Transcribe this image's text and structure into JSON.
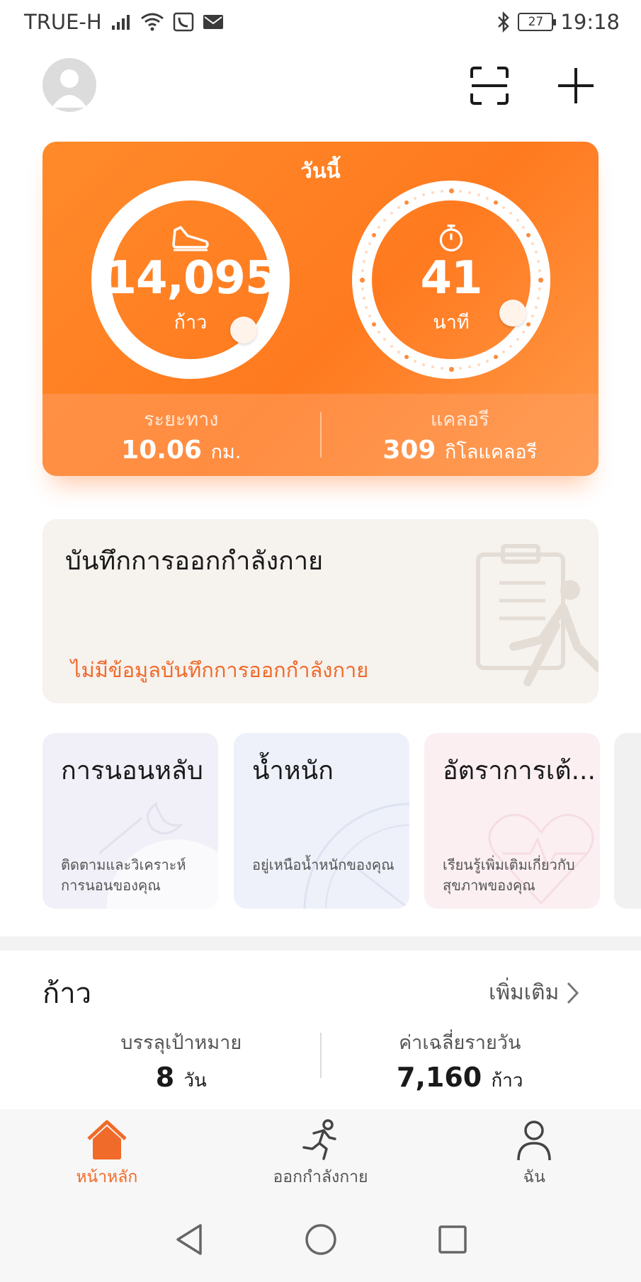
{
  "status_bar": {
    "carrier": "TRUE-H",
    "battery": "27",
    "time": "19:18"
  },
  "today": {
    "title": "วันนี้",
    "steps_value": "14,095",
    "steps_unit": "ก้าว",
    "minutes_value": "41",
    "minutes_unit": "นาที",
    "distance_label": "ระยะทาง",
    "distance_value": "10.06",
    "distance_unit": "กม.",
    "calories_label": "แคลอรี",
    "calories_value": "309",
    "calories_unit": "กิโลแคลอรี"
  },
  "exercise_record": {
    "title": "บันทึกการออกกำลังกาย",
    "empty_text": "ไม่มีข้อมูลบันทึกการออกกำลังกาย"
  },
  "mini_cards": [
    {
      "title": "การนอนหลับ",
      "description": "ติดตามและวิเคราะห์การนอนของคุณ"
    },
    {
      "title": "น้ำหนัก",
      "description": "อยู่เหนือน้ำหนักของคุณ"
    },
    {
      "title": "อัตราการเต้...",
      "description": "เรียนรู้เพิ่มเติมเกี่ยวกับสุขภาพของคุณ"
    }
  ],
  "steps_section": {
    "title": "ก้าว",
    "more": "เพิ่มเติม",
    "goal_label": "บรรลุเป้าหมาย",
    "goal_value": "8",
    "goal_unit": "วัน",
    "avg_label": "ค่าเฉลี่ยรายวัน",
    "avg_value": "7,160",
    "avg_unit": "ก้าว"
  },
  "bottom_nav": {
    "items": [
      {
        "label": "หน้าหลัก",
        "icon": "home-icon"
      },
      {
        "label": "ออกกำลังกาย",
        "icon": "running-icon"
      },
      {
        "label": "ฉัน",
        "icon": "person-icon"
      }
    ]
  },
  "colors": {
    "accent": "#f06a2a",
    "card_orange": "#ff7a1f"
  }
}
